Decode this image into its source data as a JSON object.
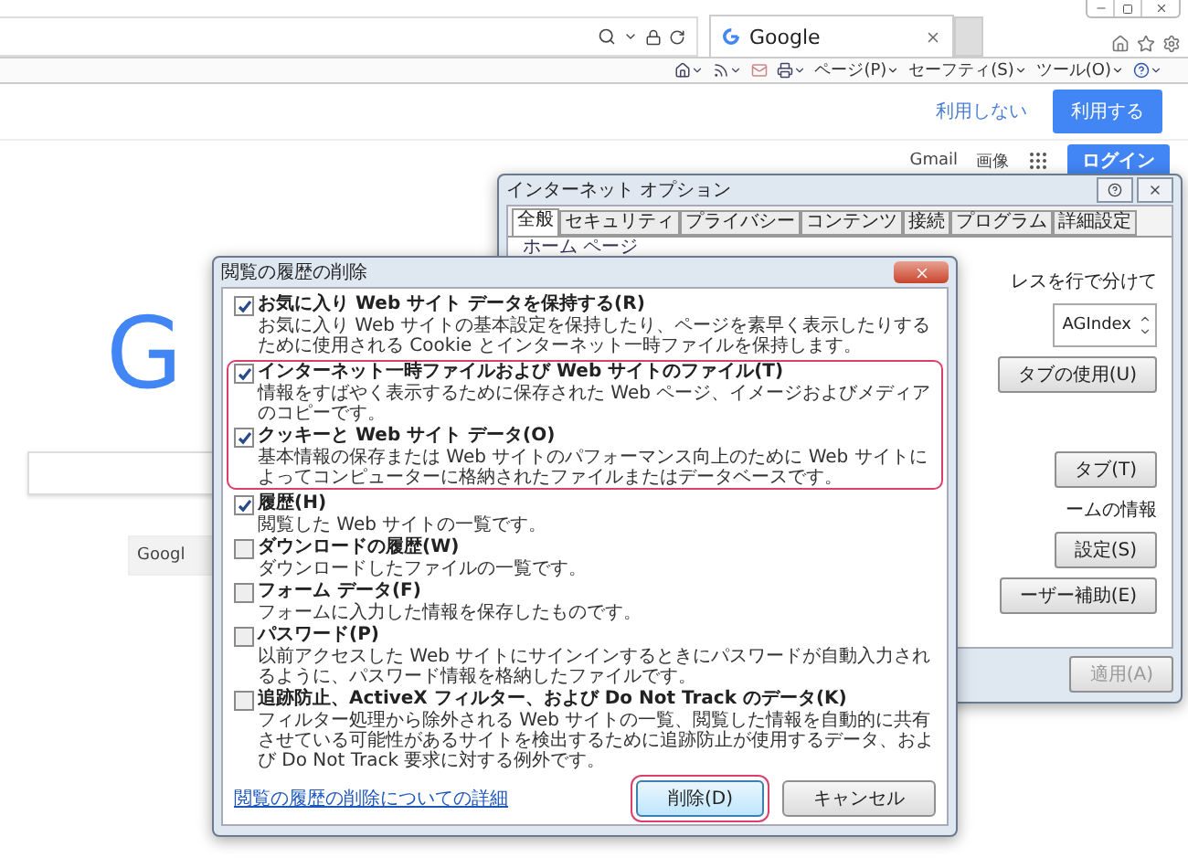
{
  "browser": {
    "tab": {
      "title": "Google"
    },
    "command_menus": [
      "ページ(P)",
      "セーフティ(S)",
      "ツール(O)"
    ]
  },
  "consent": {
    "buttons": [
      {
        "label": "利用しない",
        "kind": "link"
      },
      {
        "label": "利用する",
        "kind": "primary"
      }
    ]
  },
  "header": {
    "links": [
      "Gmail",
      "画像"
    ],
    "login": "ログイン"
  },
  "google": {
    "logo_fragment": "G",
    "button_fragment": "Googl"
  },
  "options_window": {
    "title": "インターネット オプション",
    "tabs": [
      {
        "label": "全般",
        "selected": true
      },
      {
        "label": "セキュリティ",
        "selected": false
      },
      {
        "label": "プライバシー",
        "selected": false
      },
      {
        "label": "コンテンツ",
        "selected": false
      },
      {
        "label": "接続",
        "selected": false
      },
      {
        "label": "プログラム",
        "selected": false
      },
      {
        "label": "詳細設定",
        "selected": false
      }
    ],
    "section": "ホーム ページ",
    "home_hint": "レスを行で分けて",
    "home_list_value": "AGIndex",
    "tab_buttons": [
      {
        "label": "タブの使用(U)"
      },
      {
        "label": "タブ(T)"
      }
    ],
    "section_note": "ームの情報",
    "more_buttons": [
      {
        "label": "設定(S)"
      },
      {
        "label": "ーザー補助(E)"
      }
    ],
    "apply": {
      "label": "適用(A)",
      "disabled": true
    }
  },
  "dialog": {
    "title": "閲覧の履歴の削除",
    "items": [
      {
        "title": "お気に入り Web サイト データを保持する(R)",
        "description": "お気に入り Web サイトの基本設定を保持したり、ページを素早く表示したりするために使用される Cookie とインターネット一時ファイルを保持します。",
        "checked": true,
        "highlighted": false
      },
      {
        "title": "インターネット一時ファイルおよび Web サイトのファイル(T)",
        "description": "情報をすばやく表示するために保存された Web ページ、イメージおよびメディアのコピーです。",
        "checked": true,
        "highlighted": true
      },
      {
        "title": "クッキーと Web サイト データ(O)",
        "description": "基本情報の保存または Web サイトのパフォーマンス向上のために Web サイトによってコンピューターに格納されたファイルまたはデータベースです。",
        "checked": true,
        "highlighted": true
      },
      {
        "title": "履歴(H)",
        "description": "閲覧した Web サイトの一覧です。",
        "checked": true,
        "highlighted": false
      },
      {
        "title": "ダウンロードの履歴(W)",
        "description": "ダウンロードしたファイルの一覧です。",
        "checked": false,
        "highlighted": false
      },
      {
        "title": "フォーム データ(F)",
        "description": "フォームに入力した情報を保存したものです。",
        "checked": false,
        "highlighted": false
      },
      {
        "title": "パスワード(P)",
        "description": "以前アクセスした Web サイトにサインインするときにパスワードが自動入力されるように、パスワード情報を格納したファイルです。",
        "checked": false,
        "highlighted": false
      },
      {
        "title": "追跡防止、ActiveX フィルター、および Do Not Track のデータ(K)",
        "description": "フィルター処理から除外される Web サイトの一覧、閲覧した情報を自動的に共有させている可能性があるサイトを検出するために追跡防止が使用するデータ、および Do Not Track 要求に対する例外です。",
        "checked": false,
        "highlighted": false
      }
    ],
    "link": "閲覧の履歴の削除についての詳細",
    "buttons": [
      {
        "label": "削除(D)",
        "highlighted": true
      },
      {
        "label": "キャンセル",
        "highlighted": false
      }
    ]
  }
}
